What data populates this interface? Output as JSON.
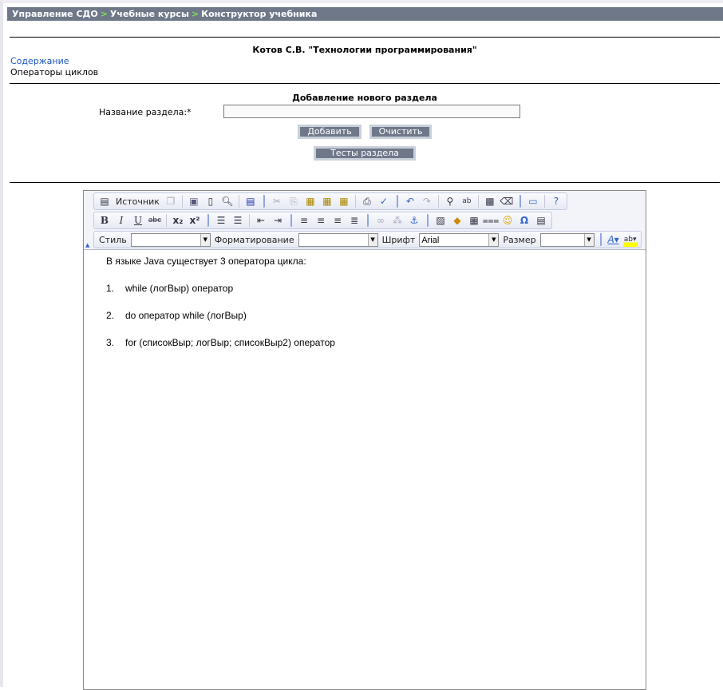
{
  "breadcrumb": [
    "Управление СДО",
    "Учебные курсы",
    "Конструктор учебника"
  ],
  "breadcrumb_sep": ">",
  "course_title": "Котов С.В. \"Технологии программирования\"",
  "toc_link": "Содержание",
  "current_section": "Операторы циклов",
  "form": {
    "heading": "Добавление нового раздела",
    "label": "Название раздела:*",
    "value": "",
    "add": "Добавить",
    "clear": "Очистить",
    "tests": "Тесты раздела"
  },
  "toolbar": {
    "source": "Источник",
    "style_label": "Стиль",
    "style_value": "",
    "format_label": "Форматирование",
    "format_value": "",
    "font_label": "Шрифт",
    "font_value": "Arial",
    "size_label": "Размер",
    "size_value": ""
  },
  "content": {
    "intro": "В языке Java существует 3 оператора цикла:",
    "items": [
      {
        "n": "1.",
        "t": "while (логВыр) оператор"
      },
      {
        "n": "2.",
        "t": "do оператор while (логВыр)"
      },
      {
        "n": "3.",
        "t": "for (списокВыр; логВыр; списокВыр2) оператор"
      }
    ]
  }
}
